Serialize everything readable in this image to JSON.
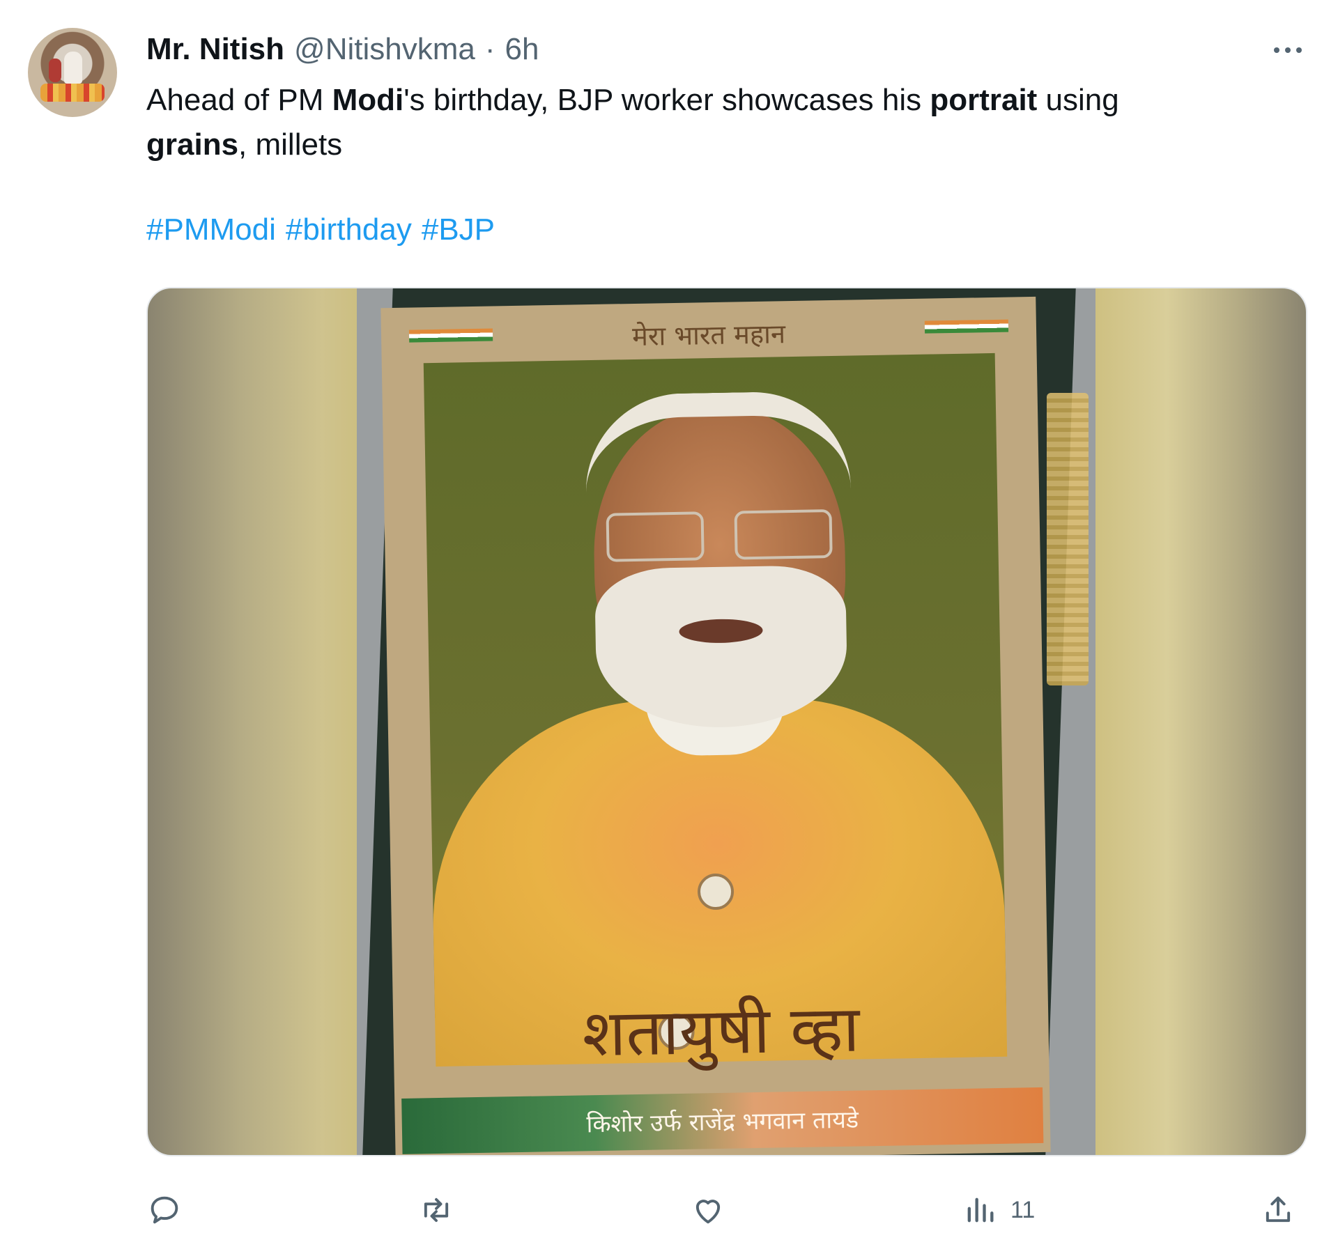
{
  "tweet": {
    "author_name": "Mr. Nitish",
    "handle": "@Nitishvkma",
    "separator": "·",
    "time": "6h",
    "text_parts": [
      {
        "t": "Ahead of PM ",
        "b": false
      },
      {
        "t": "Modi",
        "b": true
      },
      {
        "t": "'s birthday, BJP worker showcases his ",
        "b": false
      },
      {
        "t": "portrait",
        "b": true
      },
      {
        "t": " using ",
        "b": false
      },
      {
        "t": "grains",
        "b": true
      },
      {
        "t": ", millets",
        "b": false
      }
    ],
    "hashtags": [
      "#PMModi",
      "#birthday",
      "#BJP"
    ]
  },
  "media": {
    "top_text": "मेरा भारत महान",
    "title_text": "शतायुषी व्हा",
    "band_text": "किशोर उर्फ राजेंद्र भगवान तायडे"
  },
  "actions": {
    "views_count": "11"
  },
  "icons": {
    "reply": "reply-icon",
    "retweet": "retweet-icon",
    "like": "heart-icon",
    "views": "views-icon",
    "share": "share-icon",
    "more": "more-icon"
  },
  "colors": {
    "link": "#1d9bf0",
    "muted": "#536471"
  }
}
